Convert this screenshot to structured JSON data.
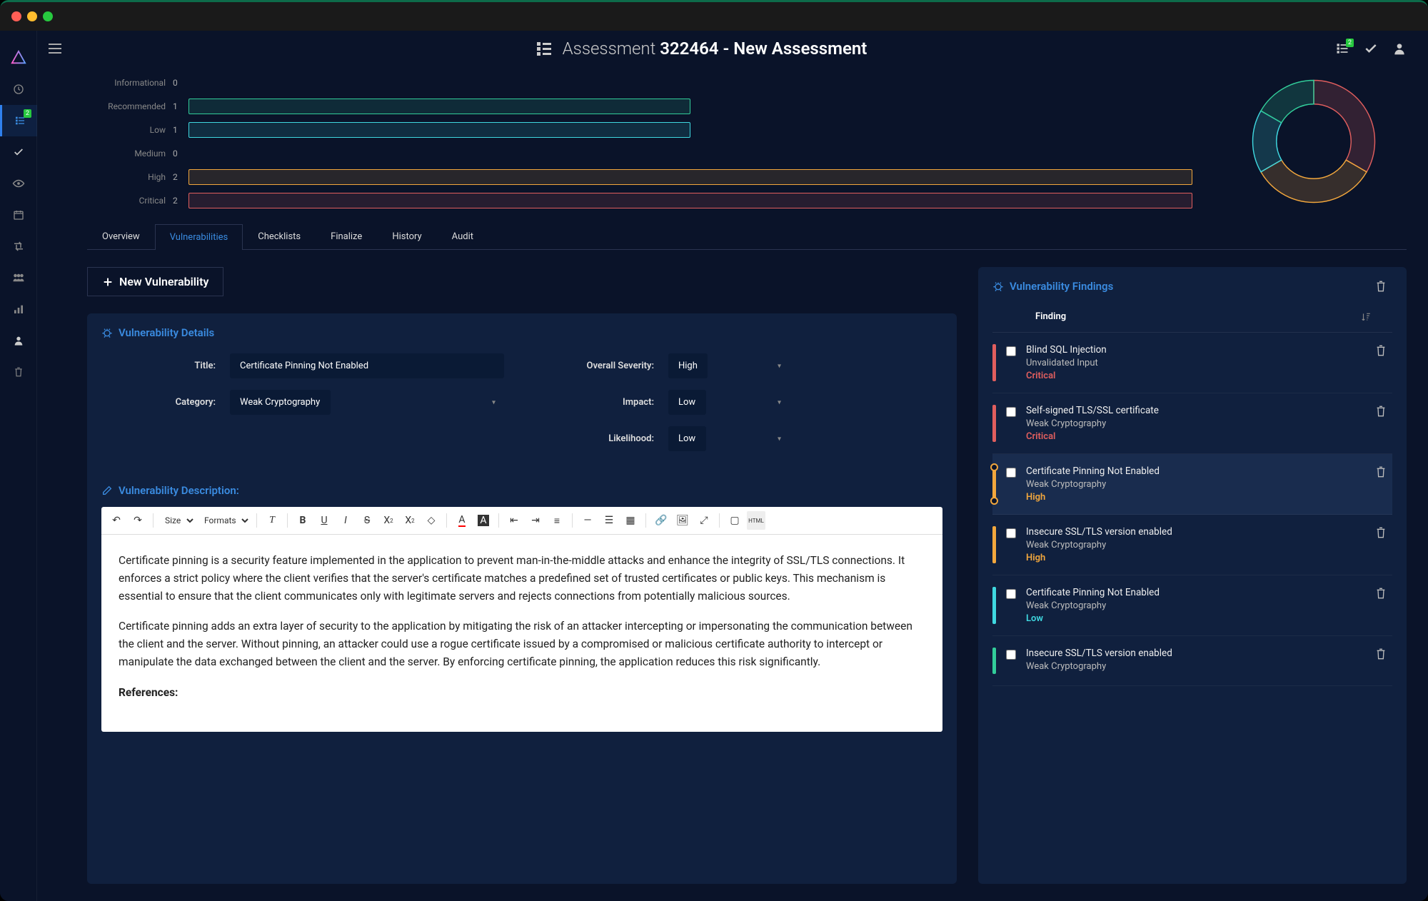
{
  "window": {
    "title_prefix": "Assessment",
    "assessment_id": "322464",
    "assessment_name": "New Assessment"
  },
  "sidebar_badge": "2",
  "topbar_badge": "2",
  "severity_colors": {
    "Informational": "#888888",
    "Recommended": "#32cd9a",
    "Low": "#3fd8e0",
    "Medium": "#888888",
    "High": "#f2a73d",
    "Critical": "#e05e5e"
  },
  "chart_data": {
    "type": "bar",
    "orientation": "horizontal",
    "categories": [
      "Informational",
      "Recommended",
      "Low",
      "Medium",
      "High",
      "Critical"
    ],
    "values": [
      0,
      1,
      1,
      0,
      2,
      2
    ],
    "xlim": [
      0,
      2
    ],
    "colors": [
      "#888888",
      "#32cd9a",
      "#3fd8e0",
      "#888888",
      "#f2a73d",
      "#e05e5e"
    ],
    "donut": {
      "type": "pie",
      "slices": [
        {
          "label": "Critical",
          "value": 2,
          "color": "#e05e5e"
        },
        {
          "label": "High",
          "value": 2,
          "color": "#f2a73d"
        },
        {
          "label": "Low",
          "value": 1,
          "color": "#3fd8e0"
        },
        {
          "label": "Recommended",
          "value": 1,
          "color": "#32cd9a"
        }
      ]
    }
  },
  "tabs": [
    "Overview",
    "Vulnerabilities",
    "Checklists",
    "Finalize",
    "History",
    "Audit"
  ],
  "active_tab": 1,
  "new_button": "New Vulnerability",
  "details_panel": {
    "title": "Vulnerability Details",
    "fields": {
      "title_label": "Title:",
      "title_value": "Certificate Pinning Not Enabled",
      "category_label": "Category:",
      "category_value": "Weak Cryptography",
      "severity_label": "Overall Severity:",
      "severity_value": "High",
      "impact_label": "Impact:",
      "impact_value": "Low",
      "likelihood_label": "Likelihood:",
      "likelihood_value": "Low"
    }
  },
  "description_panel": {
    "title": "Vulnerability Description:",
    "toolbar": {
      "size_label": "Size",
      "formats_label": "Formats"
    },
    "paragraphs": [
      "Certificate pinning is a security feature implemented in the application to prevent man-in-the-middle attacks and enhance the integrity of SSL/TLS connections. It enforces a strict policy where the client verifies that the server's certificate matches a predefined set of trusted certificates or public keys. This mechanism is essential to ensure that the client communicates only with legitimate servers and rejects connections from potentially malicious sources.",
      "Certificate pinning adds an extra layer of security to the application by mitigating the risk of an attacker intercepting or impersonating the communication between the client and the server. Without pinning, an attacker could use a rogue certificate issued by a compromised or malicious certificate authority to intercept or manipulate the data exchanged between the client and the server. By enforcing certificate pinning, the application reduces this risk significantly."
    ],
    "references_heading": "References:"
  },
  "findings_panel": {
    "title": "Vulnerability Findings",
    "column_header": "Finding",
    "rows": [
      {
        "title": "Blind SQL Injection",
        "category": "Unvalidated Input",
        "severity": "Critical"
      },
      {
        "title": "Self-signed TLS/SSL certificate",
        "category": "Weak Cryptography",
        "severity": "Critical"
      },
      {
        "title": "Certificate Pinning Not Enabled",
        "category": "Weak Cryptography",
        "severity": "High",
        "highlight": true
      },
      {
        "title": "Insecure SSL/TLS version enabled",
        "category": "Weak Cryptography",
        "severity": "High"
      },
      {
        "title": "Certificate Pinning Not Enabled",
        "category": "Weak Cryptography",
        "severity": "Low"
      },
      {
        "title": "Insecure SSL/TLS version enabled",
        "category": "Weak Cryptography",
        "severity": ""
      }
    ]
  }
}
